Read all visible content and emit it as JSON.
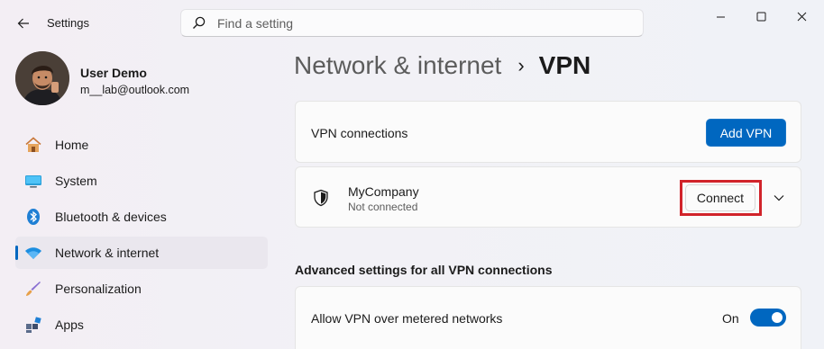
{
  "app": {
    "title": "Settings"
  },
  "search": {
    "placeholder": "Find a setting"
  },
  "user": {
    "name": "User Demo",
    "email": "m__lab@outlook.com"
  },
  "sidebar": {
    "items": [
      {
        "label": "Home",
        "icon": "home-icon"
      },
      {
        "label": "System",
        "icon": "system-icon"
      },
      {
        "label": "Bluetooth & devices",
        "icon": "bluetooth-icon"
      },
      {
        "label": "Network & internet",
        "icon": "wifi-icon",
        "active": true
      },
      {
        "label": "Personalization",
        "icon": "brush-icon"
      },
      {
        "label": "Apps",
        "icon": "apps-icon"
      }
    ]
  },
  "breadcrumb": {
    "parent": "Network & internet",
    "separator": "›",
    "current": "VPN"
  },
  "vpn_connections": {
    "label": "VPN connections",
    "add_button": "Add VPN"
  },
  "connection": {
    "name": "MyCompany",
    "status": "Not connected",
    "connect_button": "Connect"
  },
  "advanced": {
    "title": "Advanced settings for all VPN connections",
    "metered": {
      "label": "Allow VPN over metered networks",
      "state": "On",
      "enabled": true
    }
  },
  "colors": {
    "accent": "#0067c0",
    "highlight": "#d1232a"
  }
}
